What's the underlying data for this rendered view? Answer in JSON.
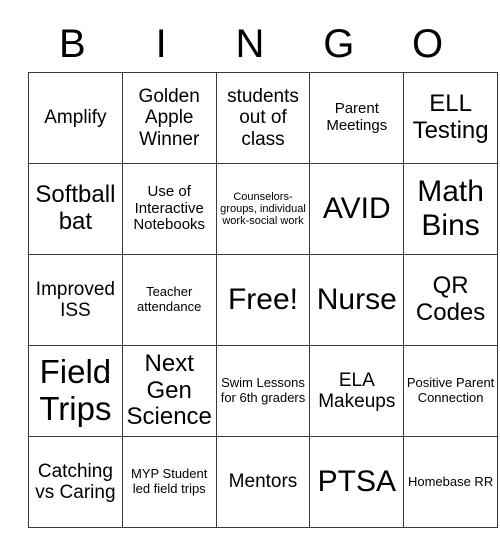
{
  "card": {
    "title": "BINGO",
    "header_letters": [
      "B",
      "I",
      "N",
      "G",
      "O"
    ],
    "rows": [
      [
        {
          "text": "Amplify",
          "size": "fs-lg"
        },
        {
          "text": "Golden Apple Winner",
          "size": "fs-lg"
        },
        {
          "text": "students out of class",
          "size": "fs-lg"
        },
        {
          "text": "Parent Meetings",
          "size": "fs-md"
        },
        {
          "text": "ELL Testing",
          "size": "fs-xl"
        }
      ],
      [
        {
          "text": "Softball bat",
          "size": "fs-xl"
        },
        {
          "text": "Use of Interactive Notebooks",
          "size": "fs-md"
        },
        {
          "text": "Counselors-groups, individual work-social work",
          "size": "fs-xs"
        },
        {
          "text": "AVID",
          "size": "fs-xxl"
        },
        {
          "text": "Math Bins",
          "size": "fs-xxl"
        }
      ],
      [
        {
          "text": "Improved ISS",
          "size": "fs-lg"
        },
        {
          "text": "Teacher attendance",
          "size": "fs-sm"
        },
        {
          "text": "Free!",
          "size": "fs-xxl"
        },
        {
          "text": "Nurse",
          "size": "fs-xxl"
        },
        {
          "text": "QR Codes",
          "size": "fs-xl"
        }
      ],
      [
        {
          "text": "Field Trips",
          "size": "fs-huge"
        },
        {
          "text": "Next Gen Science",
          "size": "fs-xl"
        },
        {
          "text": "Swim Lessons for 6th graders",
          "size": "fs-sm"
        },
        {
          "text": "ELA Makeups",
          "size": "fs-lg"
        },
        {
          "text": "Positive Parent Connection",
          "size": "fs-sm"
        }
      ],
      [
        {
          "text": "Catching vs Caring",
          "size": "fs-lg"
        },
        {
          "text": "MYP Student led field trips",
          "size": "fs-sm"
        },
        {
          "text": "Mentors",
          "size": "fs-lg"
        },
        {
          "text": "PTSA",
          "size": "fs-xxl"
        },
        {
          "text": "Homebase RR",
          "size": "fs-sm"
        }
      ]
    ]
  }
}
